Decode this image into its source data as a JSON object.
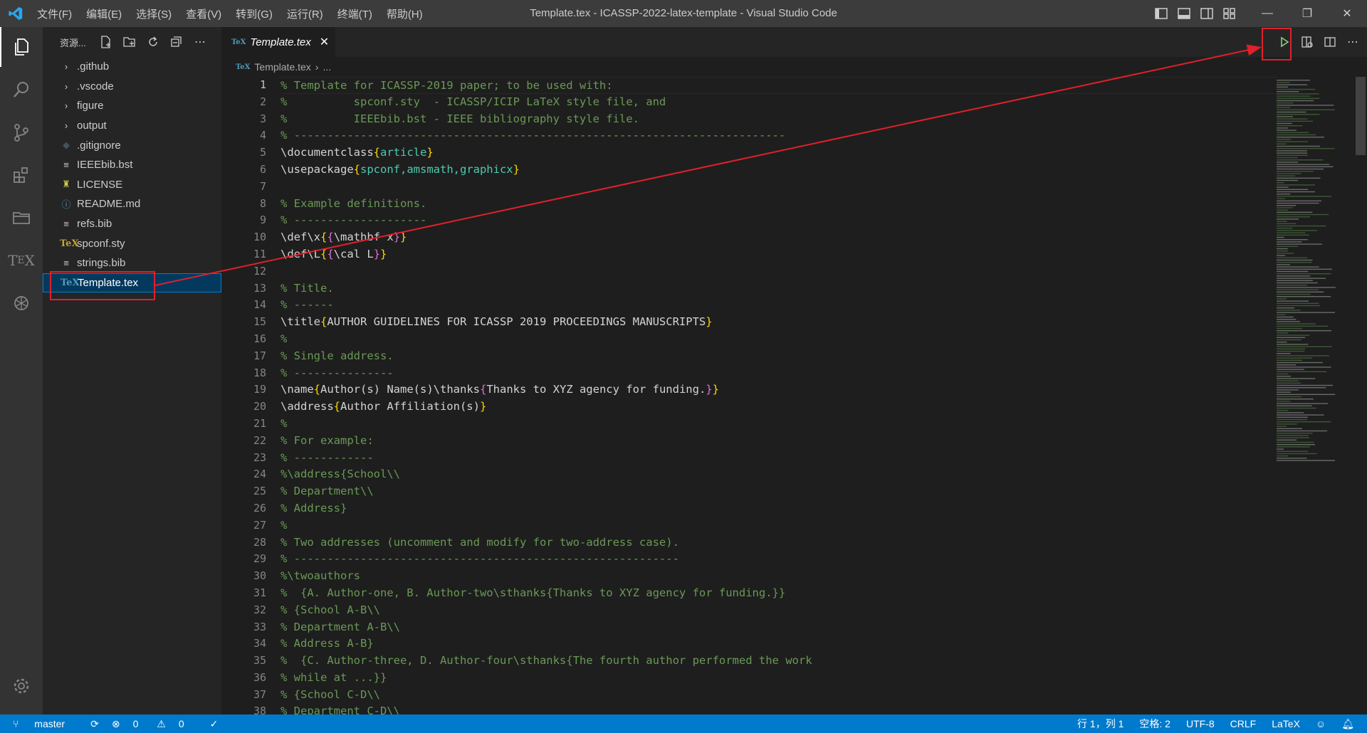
{
  "window": {
    "title": "Template.tex - ICASSP-2022-latex-template - Visual Studio Code",
    "menu": [
      "文件(F)",
      "编辑(E)",
      "选择(S)",
      "查看(V)",
      "转到(G)",
      "运行(R)",
      "终端(T)",
      "帮助(H)"
    ],
    "controls": {
      "minimize": "—",
      "restore": "❐",
      "close": "✕"
    }
  },
  "sidebar": {
    "title": "资源...",
    "items": [
      {
        "label": ".github",
        "type": "folder"
      },
      {
        "label": ".vscode",
        "type": "folder"
      },
      {
        "label": "figure",
        "type": "folder"
      },
      {
        "label": "output",
        "type": "folder"
      },
      {
        "label": ".gitignore",
        "type": "file"
      },
      {
        "label": "IEEEbib.bst",
        "type": "file"
      },
      {
        "label": "LICENSE",
        "type": "file"
      },
      {
        "label": "README.md",
        "type": "file"
      },
      {
        "label": "refs.bib",
        "type": "file"
      },
      {
        "label": "spconf.sty",
        "type": "file"
      },
      {
        "label": "strings.bib",
        "type": "file"
      },
      {
        "label": "Template.tex",
        "type": "file",
        "selected": true
      }
    ]
  },
  "tab": {
    "label": "Template.tex",
    "icon_text": "TeX",
    "close": "✕"
  },
  "breadcrumb": {
    "file": "Template.tex",
    "sep": "›",
    "rest": "..."
  },
  "editor": {
    "current_line": 1,
    "lines": [
      "% Template for ICASSP-2019 paper; to be used with:",
      "%          spconf.sty  - ICASSP/ICIP LaTeX style file, and",
      "%          IEEEbib.bst - IEEE bibliography style file.",
      "% --------------------------------------------------------------------------",
      "\\documentclass{article}",
      "\\usepackage{spconf,amsmath,graphicx}",
      "",
      "% Example definitions.",
      "% --------------------",
      "\\def\\x{{\\mathbf x}}",
      "\\def\\L{{\\cal L}}",
      "",
      "% Title.",
      "% ------",
      "\\title{AUTHOR GUIDELINES FOR ICASSP 2019 PROCEEDINGS MANUSCRIPTS}",
      "%",
      "% Single address.",
      "% ---------------",
      "\\name{Author(s) Name(s)\\thanks{Thanks to XYZ agency for funding.}}",
      "\\address{Author Affiliation(s)}",
      "%",
      "% For example:",
      "% ------------",
      "%\\address{School\\\\",
      "% Department\\\\",
      "% Address}",
      "%",
      "% Two addresses (uncomment and modify for two-address case).",
      "% ----------------------------------------------------------",
      "%\\twoauthors",
      "%  {A. Author-one, B. Author-two\\sthanks{Thanks to XYZ agency for funding.}}",
      "% {School A-B\\\\",
      "% Department A-B\\\\",
      "% Address A-B}",
      "%  {C. Author-three, D. Author-four\\sthanks{The fourth author performed the work",
      "% while at ...}}",
      "% {School C-D\\\\",
      "% Department C-D\\\\"
    ]
  },
  "statusbar": {
    "branch": "master",
    "errors": "0",
    "warnings": "0",
    "position": "行 1，列 1",
    "spaces": "空格: 2",
    "encoding": "UTF-8",
    "eol": "CRLF",
    "language": "LaTeX"
  },
  "colors": {
    "accent": "#007acc",
    "annotation": "#e0202a",
    "run_icon": "#89d185"
  }
}
